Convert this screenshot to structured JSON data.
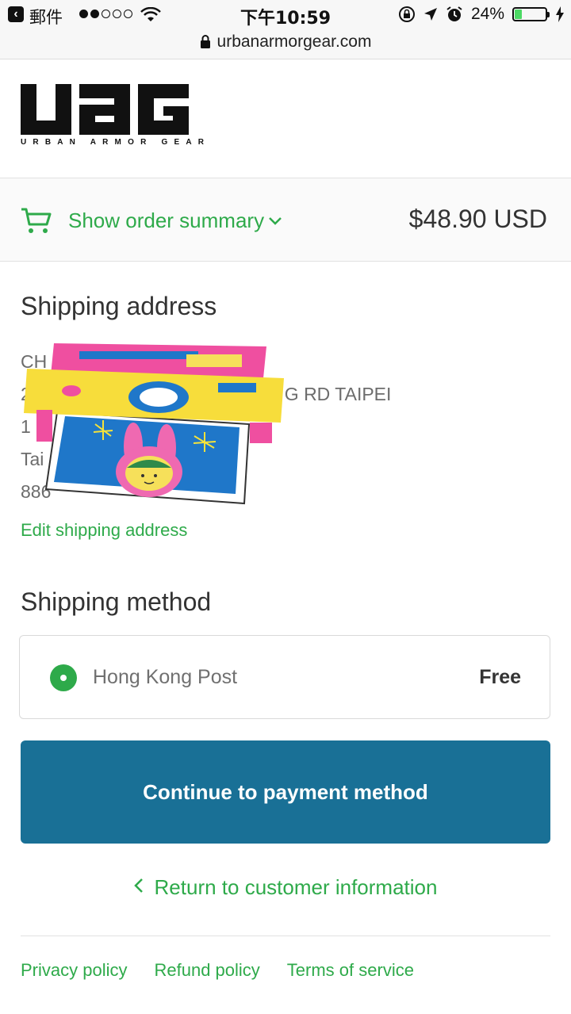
{
  "status_bar": {
    "back_app": "郵件",
    "time": "下午10:59",
    "battery": "24%",
    "battery_level": 0.24
  },
  "browser": {
    "url": "urbanarmorgear.com"
  },
  "brand": {
    "logo_text": "UAG",
    "tagline": "URBAN ARMOR GEAR"
  },
  "order_summary": {
    "toggle_label": "Show order summary",
    "total": "$48.90 USD"
  },
  "shipping_address": {
    "title": "Shipping address",
    "lines": [
      "CH",
      "2",
      "G RD TAIPEI",
      "1",
      "Tai",
      "886"
    ],
    "edit_label": "Edit shipping address"
  },
  "shipping_method": {
    "title": "Shipping method",
    "option_name": "Hong Kong Post",
    "option_price": "Free"
  },
  "actions": {
    "continue_label": "Continue to payment method",
    "return_label": "Return to customer information"
  },
  "footer": {
    "links": [
      "Privacy policy",
      "Refund policy",
      "Terms of service"
    ]
  },
  "colors": {
    "accent_green": "#2eaa4a",
    "button_blue": "#197096"
  },
  "icons": {
    "cart": "cart-icon",
    "chevron": "chevron-down-icon",
    "lock": "lock-icon",
    "back": "chevron-left-icon"
  }
}
